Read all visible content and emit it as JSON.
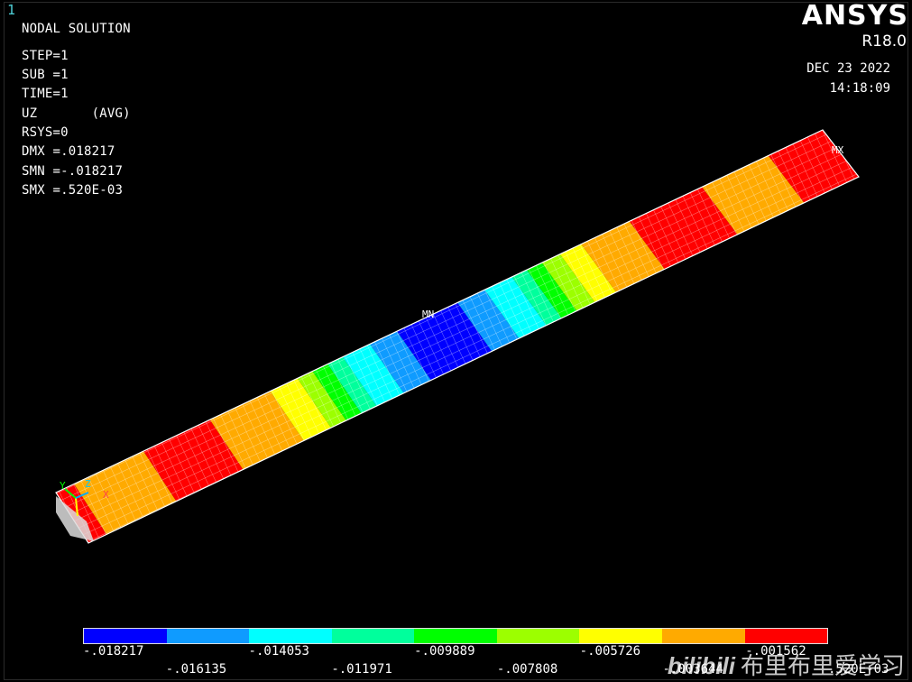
{
  "window": {
    "number": "1"
  },
  "header": {
    "title": "NODAL SOLUTION",
    "lines": [
      "STEP=1",
      "SUB =1",
      "TIME=1",
      "UZ       (AVG)",
      "RSYS=0",
      "DMX =.018217",
      "SMN =-.018217",
      "SMX =.520E-03"
    ]
  },
  "brand": {
    "logo": "ANSYS",
    "version": "R18.0",
    "date": "DEC 23 2022",
    "time": "14:18:09"
  },
  "markers": {
    "max_label": "MX",
    "min_label": "MN"
  },
  "legend": {
    "colors": [
      "#0000ff",
      "#0f9bff",
      "#00ffff",
      "#00ff9c",
      "#00ff00",
      "#9cff00",
      "#ffff00",
      "#ffaa00",
      "#ff0000"
    ],
    "labels_top": [
      "-.018217",
      "-.014053",
      "-.009889",
      "-.005726",
      "-.001562"
    ],
    "labels_bottom": [
      "-.016135",
      "-.011971",
      "-.007808",
      "-.003644",
      ".520E-03"
    ]
  },
  "beam_bands": [
    {
      "color": "#ff0000"
    },
    {
      "color": "#ffaa00"
    },
    {
      "color": "#ff0000"
    },
    {
      "color": "#ffaa00"
    },
    {
      "color": "#ffff00"
    },
    {
      "color": "#9cff00"
    },
    {
      "color": "#00ff00"
    },
    {
      "color": "#00ff9c"
    },
    {
      "color": "#00ffff"
    },
    {
      "color": "#0f9bff"
    },
    {
      "color": "#0000ff"
    },
    {
      "color": "#0f9bff"
    },
    {
      "color": "#00ffff"
    },
    {
      "color": "#00ff9c"
    },
    {
      "color": "#00ff00"
    },
    {
      "color": "#9cff00"
    },
    {
      "color": "#ffff00"
    },
    {
      "color": "#ffaa00"
    },
    {
      "color": "#ff0000"
    },
    {
      "color": "#ffaa00"
    },
    {
      "color": "#ff0000"
    }
  ],
  "axis_triad": {
    "y": "Y",
    "z": "Z",
    "x": "X"
  },
  "watermark": {
    "logo": "bilibili",
    "text": "布里布里爱学习"
  }
}
